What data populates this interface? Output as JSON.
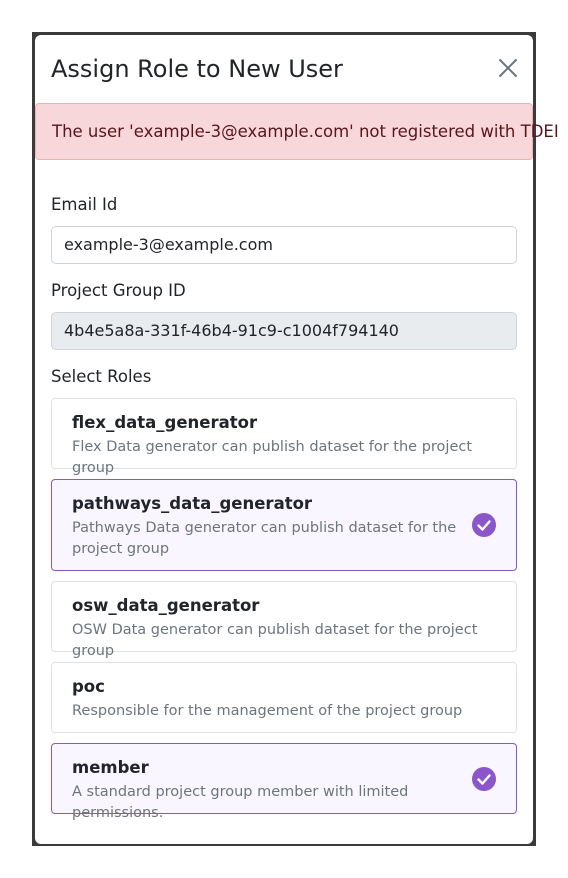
{
  "modal": {
    "title": "Assign Role to New User",
    "alert": "The user 'example-3@example.com' not registered with TDEI"
  },
  "form": {
    "email_label": "Email Id",
    "email_value": "example-3@example.com",
    "project_label": "Project Group ID",
    "project_value": "4b4e5a8a-331f-46b4-91c9-c1004f794140",
    "roles_label": "Select Roles"
  },
  "roles": [
    {
      "name": "flex_data_generator",
      "description": "Flex Data generator can publish dataset for the project group",
      "selected": false
    },
    {
      "name": "pathways_data_generator",
      "description": "Pathways Data generator can publish dataset for the project group",
      "selected": true
    },
    {
      "name": "osw_data_generator",
      "description": "OSW Data generator can publish dataset for the project group",
      "selected": false
    },
    {
      "name": "poc",
      "description": "Responsible for the management of the project group",
      "selected": false
    },
    {
      "name": "member",
      "description": "A standard project group member with limited permissions.",
      "selected": true
    }
  ],
  "colors": {
    "accent": "#8a56c9",
    "alert_bg": "#f8d7da",
    "alert_text": "#58151c"
  },
  "icons": {
    "close": "close-icon",
    "check": "check-circle-icon"
  }
}
